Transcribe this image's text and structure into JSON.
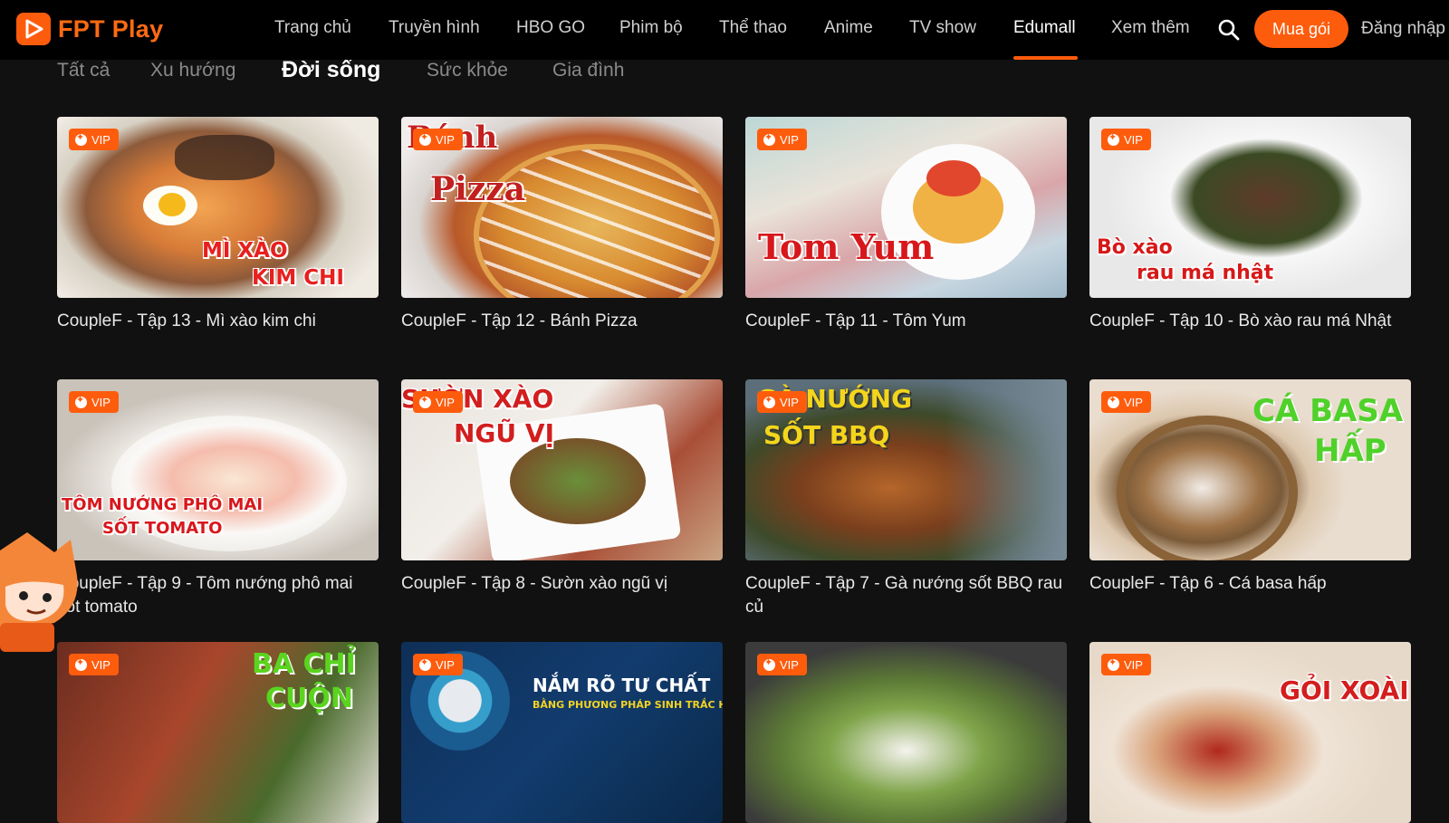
{
  "app": {
    "logo_text": "FPT Play"
  },
  "nav": {
    "items": [
      {
        "label": "Trang chủ"
      },
      {
        "label": "Truyền hình"
      },
      {
        "label": "HBO GO"
      },
      {
        "label": "Phim bộ"
      },
      {
        "label": "Thể thao"
      },
      {
        "label": "Anime"
      },
      {
        "label": "TV show"
      },
      {
        "label": "Edumall",
        "active": true
      },
      {
        "label": "Xem thêm"
      }
    ],
    "buy_label": "Mua gói",
    "login_label": "Đăng nhập"
  },
  "subtabs": [
    {
      "label": "Tất cả"
    },
    {
      "label": "Xu hướng"
    },
    {
      "label": "Đời sống",
      "active": true
    },
    {
      "label": "Sức khỏe"
    },
    {
      "label": "Gia đình"
    }
  ],
  "badge_label": "VIP",
  "cards": [
    {
      "title": "CoupleF - Tập 13 - Mì xào kim chi",
      "overlay": [
        "MÌ XÀO",
        "KIM CHI"
      ],
      "vip": true
    },
    {
      "title": "CoupleF - Tập 12 - Bánh Pizza",
      "overlay": [
        "Bánh",
        "Pizza"
      ],
      "vip": true
    },
    {
      "title": "CoupleF - Tập 11 - Tôm Yum",
      "overlay": [
        "Tom Yum"
      ],
      "vip": true
    },
    {
      "title": "CoupleF - Tập 10 - Bò xào rau má Nhật",
      "overlay": [
        "Bò xào",
        "rau má nhật"
      ],
      "vip": true
    },
    {
      "title": "CoupleF - Tập 9 - Tôm nướng phô mai sốt tomato",
      "overlay": [
        "TÔM NƯỚNG PHÔ MAI",
        "SỐT TOMATO"
      ],
      "vip": true
    },
    {
      "title": "CoupleF - Tập 8 - Sườn xào ngũ vị",
      "overlay": [
        "SƯỜN XÀO",
        "NGŨ VỊ"
      ],
      "vip": true
    },
    {
      "title": "CoupleF - Tập 7 - Gà nướng sốt BBQ rau củ",
      "overlay": [
        "GÀ NƯỚNG",
        "SỐT BBQ"
      ],
      "vip": true
    },
    {
      "title": "CoupleF - Tập 6 - Cá basa hấp",
      "overlay": [
        "CÁ BASA",
        "HẤP"
      ],
      "vip": true
    },
    {
      "title": "",
      "overlay": [
        "BA CHỈ",
        "CUỘN"
      ],
      "vip": true
    },
    {
      "title": "",
      "overlay": [
        "NẮM RÕ TƯ CHẤT",
        "BẰNG PHƯƠNG PHÁP SINH TRẮC HỌC"
      ],
      "vip": true
    },
    {
      "title": "",
      "overlay": [],
      "vip": true
    },
    {
      "title": "",
      "overlay": [
        "GỎI XOÀI"
      ],
      "vip": true
    }
  ],
  "colors": {
    "accent": "#fe5c0d",
    "background": "#111111",
    "topbar": "#000000"
  }
}
